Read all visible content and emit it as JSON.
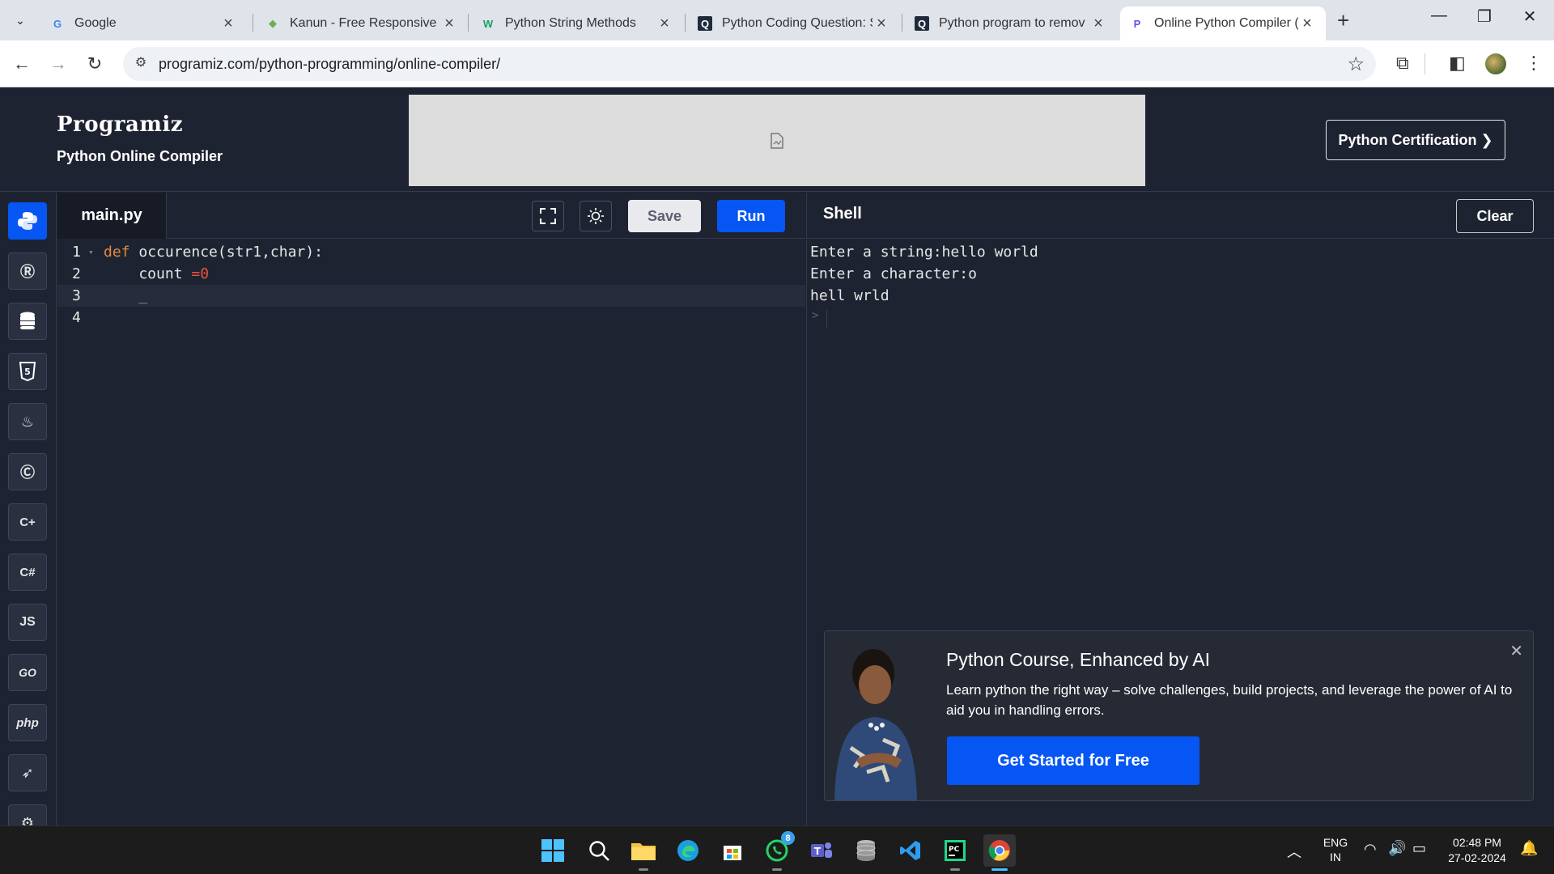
{
  "browser": {
    "tabs": [
      {
        "title": "Google",
        "favicon": "G",
        "color": "#4285f4"
      },
      {
        "title": "Kanun - Free Responsive B",
        "favicon": "K",
        "color": "#6ab04c"
      },
      {
        "title": "Python String Methods",
        "favicon": "W",
        "color": "#1aa260"
      },
      {
        "title": "Python Coding Question: S",
        "favicon": "Q",
        "color": "#ffffff"
      },
      {
        "title": "Python program to remov",
        "favicon": "Q",
        "color": "#ffffff"
      },
      {
        "title": "Online Python Compiler (In",
        "favicon": "P",
        "color": "#6b4ce6"
      }
    ],
    "url": "programiz.com/python-programming/online-compiler/"
  },
  "header": {
    "logo": "Programiz",
    "subtitle": "Python Online Compiler",
    "cert_button": "Python Certification ❯"
  },
  "rail": {
    "languages": [
      {
        "name": "python",
        "glyph": "🐍",
        "active": true
      },
      {
        "name": "r",
        "glyph": "R"
      },
      {
        "name": "sql",
        "glyph": "≡"
      },
      {
        "name": "html",
        "glyph": "5"
      },
      {
        "name": "java",
        "glyph": "♨"
      },
      {
        "name": "c",
        "glyph": "C"
      },
      {
        "name": "cpp",
        "glyph": "C+"
      },
      {
        "name": "csharp",
        "glyph": "C#"
      },
      {
        "name": "js",
        "glyph": "JS"
      },
      {
        "name": "go",
        "glyph": "GO"
      },
      {
        "name": "php",
        "glyph": "php"
      },
      {
        "name": "swift",
        "glyph": "➶"
      },
      {
        "name": "rust",
        "glyph": "R"
      }
    ]
  },
  "editor": {
    "filename": "main.py",
    "save_label": "Save",
    "run_label": "Run",
    "lines": [
      {
        "n": "1",
        "text": "def occurence(str1,char):"
      },
      {
        "n": "2",
        "text": "    count =0"
      },
      {
        "n": "3",
        "text": "    _"
      },
      {
        "n": "4",
        "text": ""
      }
    ]
  },
  "shell": {
    "title": "Shell",
    "clear_label": "Clear",
    "output": [
      "Enter a string:hello world",
      "Enter a character:o",
      "hell wrld"
    ],
    "prompt": ">"
  },
  "promo": {
    "title": "Python Course, Enhanced by AI",
    "text": "Learn python the right way – solve challenges, build projects, and leverage the power of AI to aid you in handling errors.",
    "button": "Get Started for Free"
  },
  "taskbar": {
    "whatsapp_badge": "8",
    "lang_line1": "ENG",
    "lang_line2": "IN",
    "time": "02:48 PM",
    "date": "27-02-2024"
  }
}
